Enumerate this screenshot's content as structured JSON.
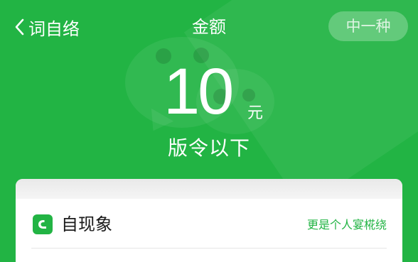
{
  "header": {
    "back_label": "词自络",
    "title": "金额",
    "action_label": "中一种"
  },
  "amount": {
    "value": "10",
    "unit": "元"
  },
  "subtitle": "版令以下",
  "card": {
    "app_name": "自现象",
    "link_label": "更是个人宴椛绕"
  },
  "colors": {
    "brand_green": "#22b444",
    "card_bg": "#ffffff"
  },
  "icons": {
    "back": "chevron-left-icon",
    "app": "wechat-phone-icon"
  }
}
